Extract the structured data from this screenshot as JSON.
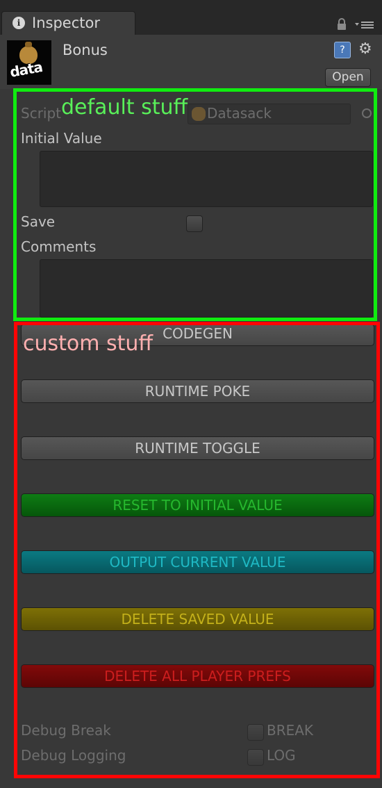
{
  "tab": {
    "icon": "info-icon",
    "icon_glyph": "i",
    "label": "Inspector"
  },
  "header": {
    "asset_name": "Bonus",
    "asset_icon_text": "data",
    "open_label": "Open"
  },
  "default_fields": {
    "script_label": "Script",
    "script_value": "Datasack",
    "initial_value_label": "Initial Value",
    "initial_value": "",
    "save_label": "Save",
    "save_checked": false,
    "comments_label": "Comments",
    "comments": ""
  },
  "buttons": {
    "codegen": "CODEGEN",
    "runtime_poke": "RUNTIME POKE",
    "runtime_toggle": "RUNTIME TOGGLE",
    "reset": "RESET TO INITIAL VALUE",
    "output": "OUTPUT CURRENT VALUE",
    "delete_saved": "DELETE SAVED VALUE",
    "delete_all": "DELETE ALL PLAYER PREFS"
  },
  "debug": {
    "break_label": "Debug Break",
    "break_toggle_label": "BREAK",
    "logging_label": "Debug Logging",
    "logging_toggle_label": "LOG"
  },
  "annotations": {
    "default": "default stuff",
    "custom": "custom stuff"
  },
  "colors": {
    "green_box": "#10ec10",
    "red_box": "#ff0505",
    "reset_button": "#0e7c14",
    "output_button": "#0a7a82",
    "delete_saved_button": "#7e7006",
    "delete_all_button": "#820a0a"
  }
}
